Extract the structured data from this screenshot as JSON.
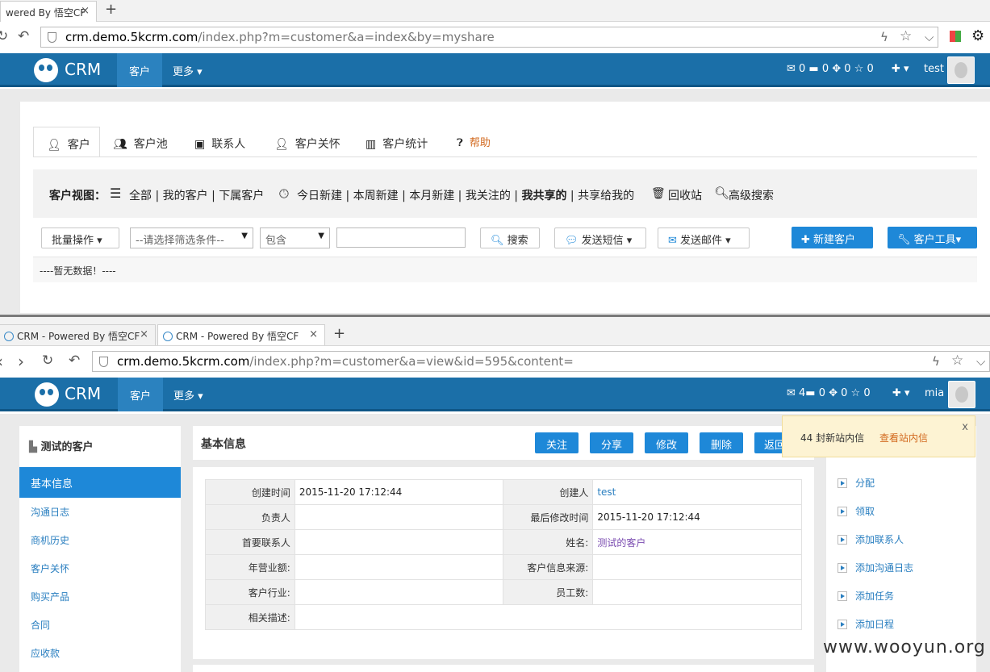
{
  "window1": {
    "tab_title": "wered By 悟空CF",
    "url_host": "crm.demo.5kcrm.com",
    "url_path": "/index.php?m=customer&a=index&by=myshare"
  },
  "window2": {
    "tabs": [
      {
        "title": "CRM - Powered By 悟空CF"
      },
      {
        "title": "CRM - Powered By 悟空CF"
      }
    ],
    "url_host": "crm.demo.5kcrm.com",
    "url_path": "/index.php?m=customer&a=view&id=595&content="
  },
  "crm": {
    "brand": "CRM",
    "nav_customer": "客户",
    "nav_more": "更多 ▾",
    "plus": "✚ ▾",
    "top_counts": "✉ 0 ▬ 0 ✥ 0 ☆ 0",
    "top_user": "test",
    "bottom_counts": "✉ 4▬ 0 ✥ 0 ☆ 0",
    "bottom_user": "mia"
  },
  "customer_tabs": [
    {
      "label": "客户",
      "icon": "user-icon"
    },
    {
      "label": "客户池",
      "icon": "users-icon"
    },
    {
      "label": "联系人",
      "icon": "contacts-book-icon"
    },
    {
      "label": "客户关怀",
      "icon": "user-care-icon"
    },
    {
      "label": "客户统计",
      "icon": "bar-chart-icon"
    },
    {
      "label": "帮助",
      "icon": "help-icon"
    }
  ],
  "view_bar": {
    "label": "客户视图：",
    "group1": "全部 | 我的客户 | 下属客户",
    "group2_a": "今日新建 | 本周新建 | 本月新建 | 我关注的 | ",
    "group2_active": "我共享的",
    "group2_b": " | 共享给我的",
    "recycle": "回收站",
    "advanced": "高级搜索"
  },
  "toolbar": {
    "batch": "批量操作 ▾",
    "filter_placeholder": "--请选择筛选条件--",
    "contains": "包含",
    "search": "搜索",
    "sms": "发送短信 ▾",
    "email": "发送邮件 ▾",
    "new_customer": "新建客户",
    "tools": "客户工具▾"
  },
  "no_data": "----暂无数据！----",
  "detail": {
    "side_title": "测试的客户",
    "side_items": [
      "基本信息",
      "沟通日志",
      "商机历史",
      "客户关怀",
      "购买产品",
      "合同",
      "应收款"
    ],
    "header_title": "基本信息",
    "actions": [
      "关注",
      "分享",
      "修改",
      "删除",
      "返回"
    ],
    "rows": [
      {
        "l1": "创建时间",
        "v1": "2015-11-20 17:12:44",
        "l2": "创建人",
        "v2": "test"
      },
      {
        "l1": "负责人",
        "v1": "",
        "l2": "最后修改时间",
        "v2": "2015-11-20 17:12:44"
      },
      {
        "l1": "首要联系人",
        "v1": "",
        "l2": "姓名:",
        "v2": "测试的客户"
      },
      {
        "l1": "年营业额:",
        "v1": "",
        "l2": "客户信息来源:",
        "v2": ""
      },
      {
        "l1": "客户行业:",
        "v1": "",
        "l2": "员工数:",
        "v2": ""
      }
    ],
    "desc_label": "相关描述:",
    "desc_value": "",
    "right_items": [
      "分配",
      "领取",
      "添加联系人",
      "添加沟通日志",
      "添加任务",
      "添加日程"
    ]
  },
  "notice": {
    "text": "44 封新站内信",
    "link": "查看站内信",
    "close": "x"
  },
  "watermark": "www.wooyun.org"
}
